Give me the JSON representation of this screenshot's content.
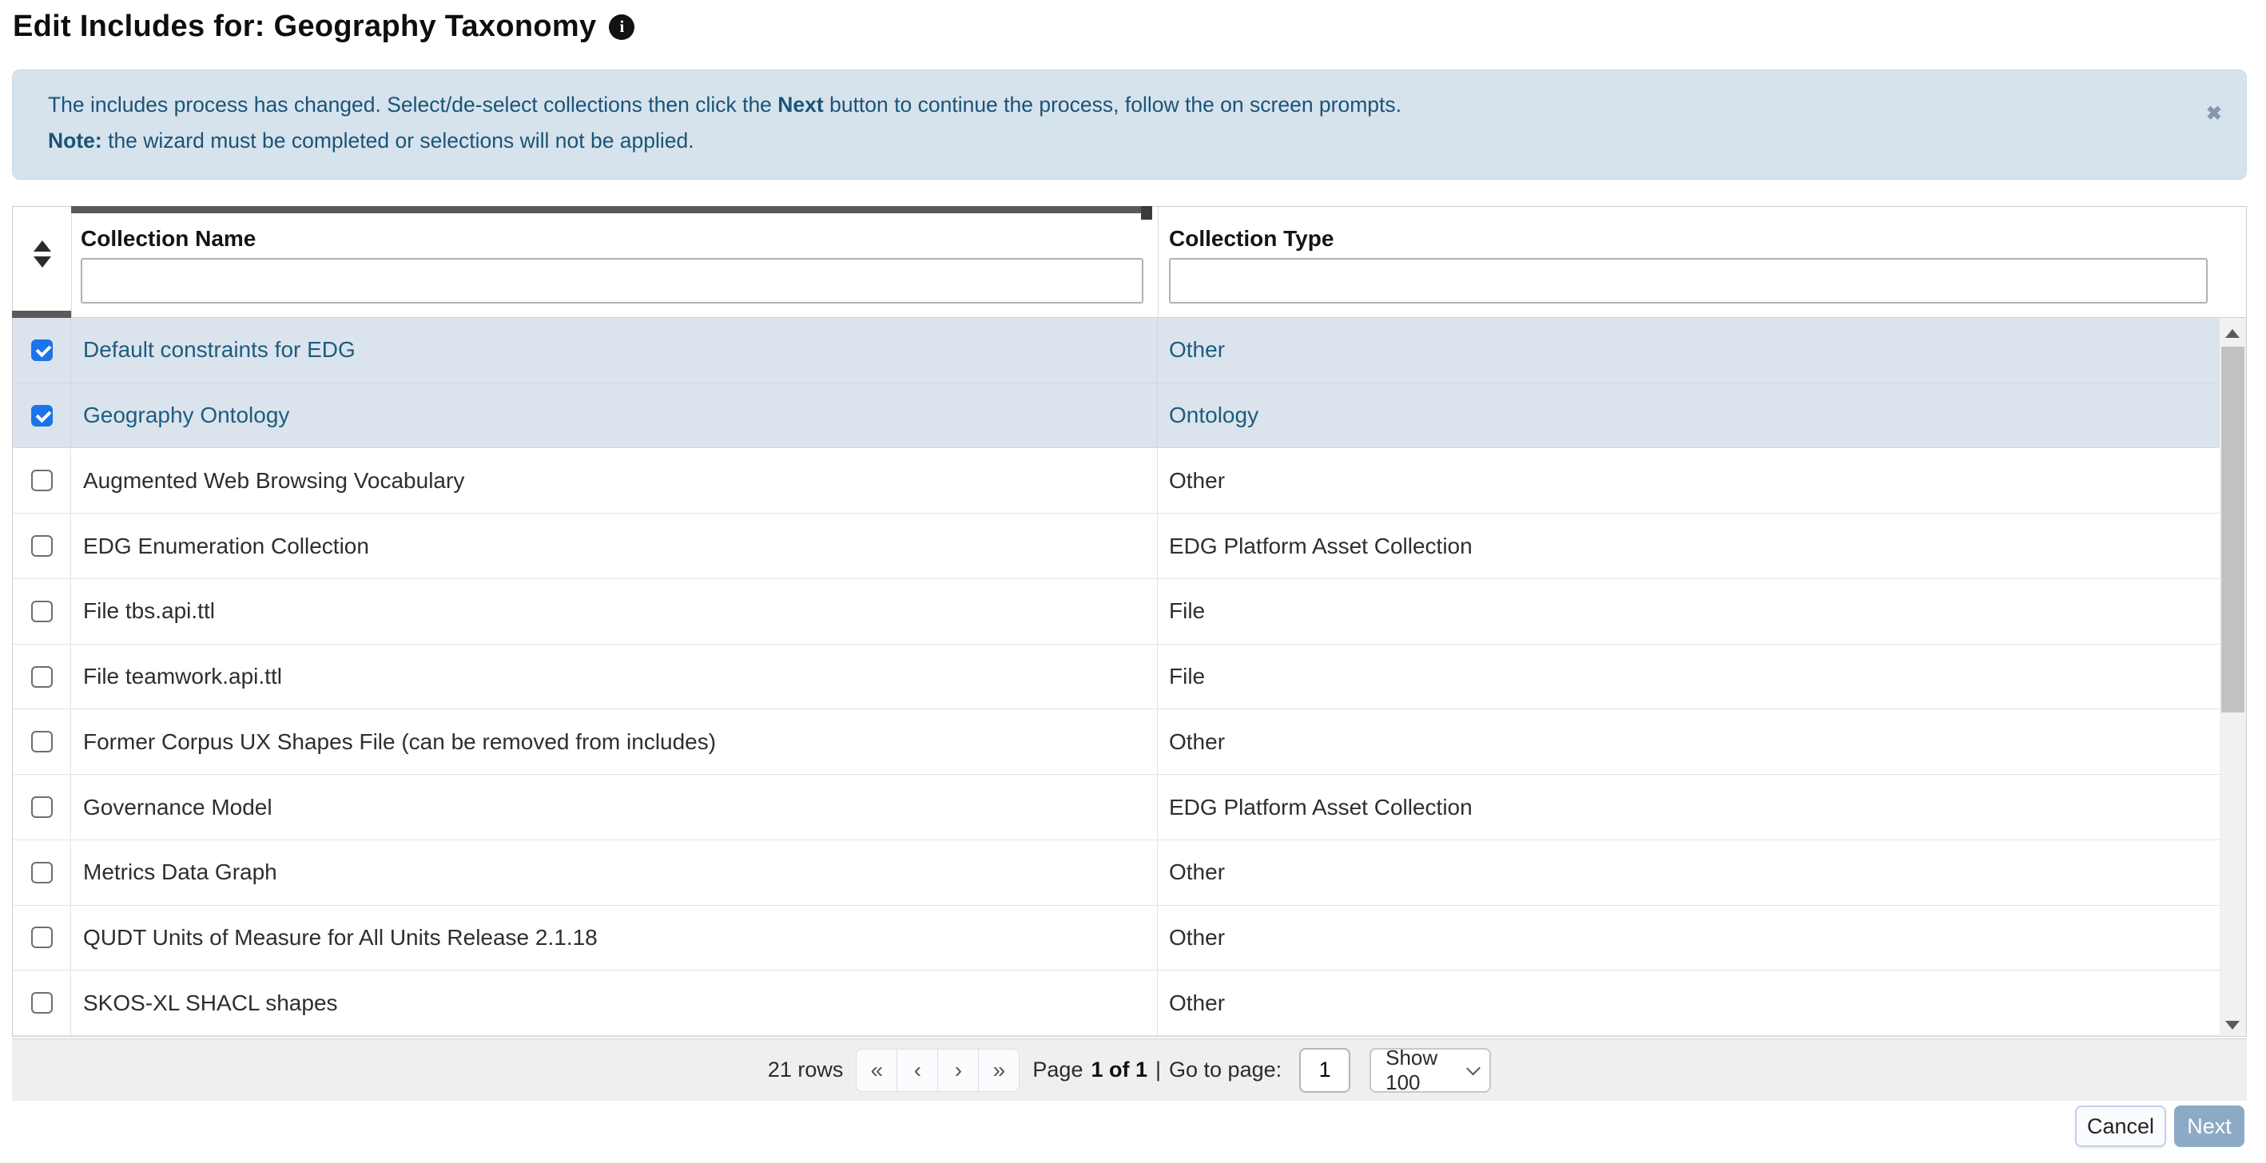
{
  "page": {
    "title": "Edit Includes for: Geography Taxonomy",
    "info_icon_glyph": "i"
  },
  "banner": {
    "line1_pre": "The includes process has changed. Select/de-select collections then click the ",
    "line1_bold": "Next",
    "line1_post": " button to continue the process, follow the on screen prompts.",
    "line2_bold": "Note:",
    "line2_text": " the wizard must be completed or selections will not be applied.",
    "close_glyph": "✖"
  },
  "table": {
    "columns": {
      "name_label": "Collection Name",
      "type_label": "Collection Type"
    },
    "filters": {
      "name_value": "",
      "type_value": ""
    },
    "rows": [
      {
        "name": "Default constraints for EDG",
        "type": "Other",
        "checked": true
      },
      {
        "name": "Geography Ontology",
        "type": "Ontology",
        "checked": true
      },
      {
        "name": "Augmented Web Browsing Vocabulary",
        "type": "Other",
        "checked": false
      },
      {
        "name": "EDG Enumeration Collection",
        "type": "EDG Platform Asset Collection",
        "checked": false
      },
      {
        "name": "File tbs.api.ttl",
        "type": "File",
        "checked": false
      },
      {
        "name": "File teamwork.api.ttl",
        "type": "File",
        "checked": false
      },
      {
        "name": "Former Corpus UX Shapes File (can be removed from includes)",
        "type": "Other",
        "checked": false
      },
      {
        "name": "Governance Model",
        "type": "EDG Platform Asset Collection",
        "checked": false
      },
      {
        "name": "Metrics Data Graph",
        "type": "Other",
        "checked": false
      },
      {
        "name": "QUDT Units of Measure for All Units Release 2.1.18",
        "type": "Other",
        "checked": false
      },
      {
        "name": "SKOS-XL SHACL shapes",
        "type": "Other",
        "checked": false
      }
    ]
  },
  "pagination": {
    "rows_count": "21 rows",
    "first_glyph": "«",
    "prev_glyph": "‹",
    "next_glyph": "›",
    "last_glyph": "»",
    "page_word": "Page",
    "page_value": "1 of 1",
    "separator": "|",
    "goto_label": "Go to page:",
    "goto_value": "1",
    "show_label": "Show 100"
  },
  "actions": {
    "cancel_label": "Cancel",
    "next_label": "Next"
  },
  "colors": {
    "banner_bg": "#d6e3ed",
    "banner_text": "#1b5377",
    "selected_row_bg": "#dbe4ed",
    "selected_row_text": "#1e5c80",
    "checkbox_accent": "#1b74e8",
    "next_button_bg": "#8caac6",
    "footer_bg": "#efefef"
  }
}
